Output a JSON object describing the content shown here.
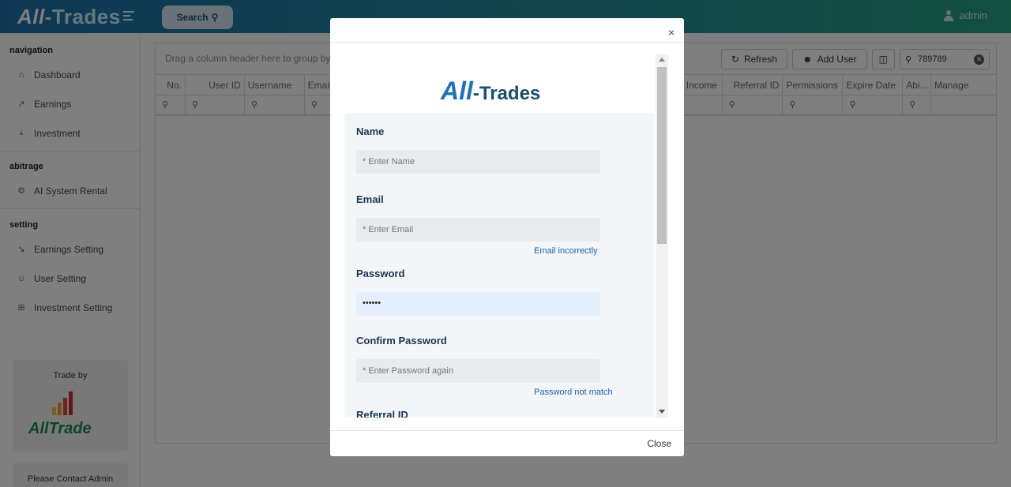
{
  "app": {
    "logo_main": "All",
    "logo_rest": "-Trades",
    "search_label": "Search",
    "user_name": "admin"
  },
  "sidebar": {
    "sections": [
      {
        "title": "navigation",
        "items": [
          {
            "label": "Dashboard",
            "icon": "home-icon"
          },
          {
            "label": "Earnings",
            "icon": "trend-up-icon"
          },
          {
            "label": "Investment",
            "icon": "download-icon"
          }
        ]
      },
      {
        "title": "abitrage",
        "items": [
          {
            "label": "AI System Rental",
            "icon": "gear-icon"
          }
        ]
      },
      {
        "title": "setting",
        "items": [
          {
            "label": "Earnings Setting",
            "icon": "trend-down-icon"
          },
          {
            "label": "User Setting",
            "icon": "user-icon"
          },
          {
            "label": "Investment Setting",
            "icon": "sliders-icon"
          }
        ]
      }
    ],
    "trade_by_label": "Trade by",
    "trade_by_logo_a": "All",
    "trade_by_logo_b": "Trade",
    "contact_label": "Please Contact Admin"
  },
  "grid": {
    "group_panel_text": "Drag a column header here to group by",
    "refresh_label": "Refresh",
    "add_user_label": "Add User",
    "search_value": "789789",
    "columns": [
      "No.",
      "User ID",
      "Username",
      "Email",
      "Income",
      "Referral ID",
      "Permissions",
      "Expire Date",
      "Abi...",
      "Manage"
    ]
  },
  "modal": {
    "close_x": "×",
    "logo_a": "All",
    "logo_b": "-Trades",
    "fields": {
      "name_label": "Name",
      "name_placeholder": "* Enter Name",
      "email_label": "Email",
      "email_placeholder": "* Enter Email",
      "email_error": "Email incorrectly",
      "password_label": "Password",
      "password_value": "••••••",
      "confirm_label": "Confirm Password",
      "confirm_placeholder": "* Enter Password again",
      "confirm_error": "Password not match",
      "referral_label": "Referral ID"
    },
    "close_button": "Close"
  }
}
